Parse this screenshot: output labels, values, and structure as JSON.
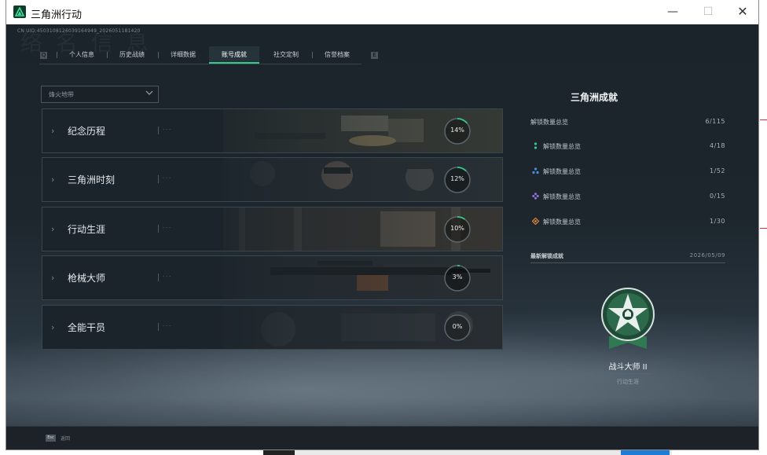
{
  "window": {
    "title": "三角洲行动",
    "controls": {
      "minimize": "—",
      "maximize": "☐",
      "close": "✕"
    }
  },
  "header": {
    "uid": "CN UID:4503108126039164949_2026051181420",
    "ghost_text": "络 名 信 息"
  },
  "tabs": [
    {
      "label": "个人信息",
      "active": false
    },
    {
      "label": "历史战绩",
      "active": false
    },
    {
      "label": "详细数据",
      "active": false
    },
    {
      "label": "账号成就",
      "active": true
    },
    {
      "label": "社交定制",
      "active": false
    },
    {
      "label": "信誉档案",
      "active": false
    }
  ],
  "tab_edges": {
    "left": "Q",
    "right": "E"
  },
  "filter": {
    "value": "烽火地带"
  },
  "categories": [
    {
      "name": "纪念历程",
      "percent": 14,
      "percent_label": "14%"
    },
    {
      "name": "三角洲时刻",
      "percent": 12,
      "percent_label": "12%"
    },
    {
      "name": "行动生涯",
      "percent": 10,
      "percent_label": "10%"
    },
    {
      "name": "枪械大师",
      "percent": 3,
      "percent_label": "3%"
    },
    {
      "name": "全能干员",
      "percent": 0,
      "percent_label": "0%"
    }
  ],
  "colors": {
    "accent": "#37c98a",
    "ring_track": "#5a656c"
  },
  "achievements_panel": {
    "title": "三角洲成就",
    "summary": {
      "label": "解锁数量总览",
      "value": "6/115"
    },
    "tiers": [
      {
        "label": "解锁数量总览",
        "value": "4/18",
        "icon": "green-tier-icon",
        "color": "#39c98b"
      },
      {
        "label": "解锁数量总览",
        "value": "1/52",
        "icon": "blue-tier-icon",
        "color": "#4a8fe0"
      },
      {
        "label": "解锁数量总览",
        "value": "0/15",
        "icon": "purple-tier-icon",
        "color": "#9a6ee0"
      },
      {
        "label": "解锁数量总览",
        "value": "1/30",
        "icon": "orange-tier-icon",
        "color": "#e08a3a"
      }
    ],
    "recent": {
      "label": "最新解锁成就",
      "date": "2026/05/09"
    },
    "medal": {
      "name": "战斗大师 II",
      "category": "行动生涯"
    }
  },
  "footer": {
    "key": "Esc",
    "label": "返回"
  }
}
